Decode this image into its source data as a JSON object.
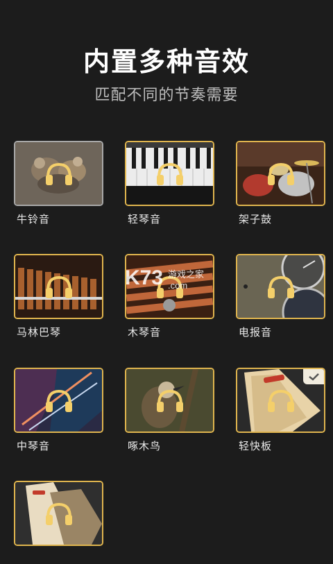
{
  "header": {
    "title": "内置多种音效",
    "subtitle": "匹配不同的节奏需要"
  },
  "sounds": [
    {
      "label": "牛铃音",
      "icon": "headphones-icon",
      "bg": "#6e655a",
      "selected": false,
      "highlight": "grey"
    },
    {
      "label": "轻琴音",
      "icon": "headphones-icon",
      "bg": "#3a3a3a",
      "selected": false,
      "highlight": "gold"
    },
    {
      "label": "架子鼓",
      "icon": "headphones-icon",
      "bg": "#5a3a2a",
      "selected": false,
      "highlight": "gold"
    },
    {
      "label": "马林巴琴",
      "icon": "headphones-icon",
      "bg": "#7a4a24",
      "selected": false,
      "highlight": "gold"
    },
    {
      "label": "木琴音",
      "icon": "headphones-icon",
      "bg": "#6b3b22",
      "selected": false,
      "highlight": "gold"
    },
    {
      "label": "电报音",
      "icon": "headphones-icon",
      "bg": "#6a6553",
      "selected": false,
      "highlight": "gold"
    },
    {
      "label": "中琴音",
      "icon": "headphones-icon",
      "bg": "#4d2e52",
      "selected": false,
      "highlight": "gold"
    },
    {
      "label": "啄木鸟",
      "icon": "headphones-icon",
      "bg": "#4a4a30",
      "selected": false,
      "highlight": "gold"
    },
    {
      "label": "轻快板",
      "icon": "headphones-icon",
      "bg": "#b9a077",
      "selected": true,
      "highlight": "gold"
    },
    {
      "label": "",
      "icon": "headphones-icon",
      "bg": "#9a8565",
      "selected": false,
      "highlight": "gold"
    }
  ],
  "watermark": {
    "brand": "K73",
    "site": "游戏之家",
    "domain": ".com"
  },
  "colors": {
    "accent": "#e0b54e",
    "background": "#1c1c1c",
    "icon": "#f4cf6a"
  }
}
